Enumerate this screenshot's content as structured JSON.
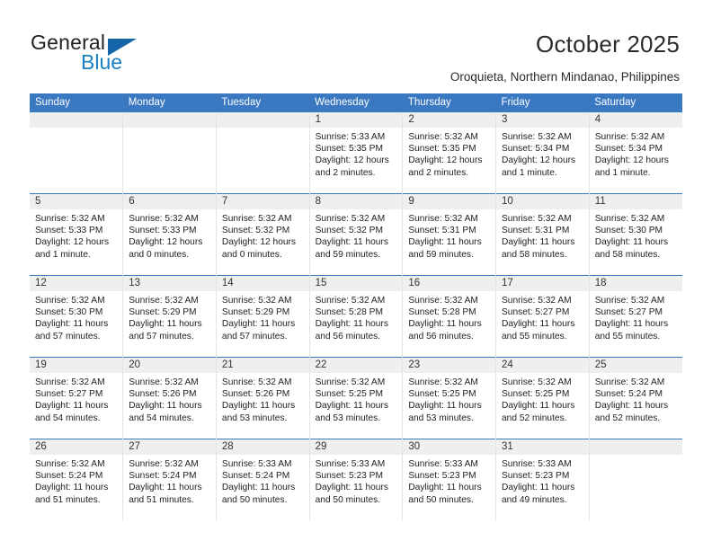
{
  "brand": {
    "name_top": "General",
    "name_bottom": "Blue",
    "accent_color": "#1a7fc1",
    "triangle_color": "#1565a8"
  },
  "header": {
    "title": "October 2025",
    "subtitle": "Oroquieta, Northern Mindanao, Philippines"
  },
  "colors": {
    "header_row_bg": "#3b78c2",
    "header_row_text": "#ffffff",
    "daynum_band_bg": "#efefef",
    "cell_divider": "#e4e4e4",
    "week_divider": "#3b78c2"
  },
  "weekdays": [
    "Sunday",
    "Monday",
    "Tuesday",
    "Wednesday",
    "Thursday",
    "Friday",
    "Saturday"
  ],
  "labels": {
    "sunrise_prefix": "Sunrise:",
    "sunset_prefix": "Sunset:",
    "daylight_prefix": "Daylight:"
  },
  "weeks": [
    [
      {
        "day": "",
        "empty": true
      },
      {
        "day": "",
        "empty": true
      },
      {
        "day": "",
        "empty": true
      },
      {
        "day": "1",
        "sunrise": "Sunrise: 5:33 AM",
        "sunset": "Sunset: 5:35 PM",
        "daylight_1": "Daylight: 12 hours",
        "daylight_2": "and 2 minutes."
      },
      {
        "day": "2",
        "sunrise": "Sunrise: 5:32 AM",
        "sunset": "Sunset: 5:35 PM",
        "daylight_1": "Daylight: 12 hours",
        "daylight_2": "and 2 minutes."
      },
      {
        "day": "3",
        "sunrise": "Sunrise: 5:32 AM",
        "sunset": "Sunset: 5:34 PM",
        "daylight_1": "Daylight: 12 hours",
        "daylight_2": "and 1 minute."
      },
      {
        "day": "4",
        "sunrise": "Sunrise: 5:32 AM",
        "sunset": "Sunset: 5:34 PM",
        "daylight_1": "Daylight: 12 hours",
        "daylight_2": "and 1 minute."
      }
    ],
    [
      {
        "day": "5",
        "sunrise": "Sunrise: 5:32 AM",
        "sunset": "Sunset: 5:33 PM",
        "daylight_1": "Daylight: 12 hours",
        "daylight_2": "and 1 minute."
      },
      {
        "day": "6",
        "sunrise": "Sunrise: 5:32 AM",
        "sunset": "Sunset: 5:33 PM",
        "daylight_1": "Daylight: 12 hours",
        "daylight_2": "and 0 minutes."
      },
      {
        "day": "7",
        "sunrise": "Sunrise: 5:32 AM",
        "sunset": "Sunset: 5:32 PM",
        "daylight_1": "Daylight: 12 hours",
        "daylight_2": "and 0 minutes."
      },
      {
        "day": "8",
        "sunrise": "Sunrise: 5:32 AM",
        "sunset": "Sunset: 5:32 PM",
        "daylight_1": "Daylight: 11 hours",
        "daylight_2": "and 59 minutes."
      },
      {
        "day": "9",
        "sunrise": "Sunrise: 5:32 AM",
        "sunset": "Sunset: 5:31 PM",
        "daylight_1": "Daylight: 11 hours",
        "daylight_2": "and 59 minutes."
      },
      {
        "day": "10",
        "sunrise": "Sunrise: 5:32 AM",
        "sunset": "Sunset: 5:31 PM",
        "daylight_1": "Daylight: 11 hours",
        "daylight_2": "and 58 minutes."
      },
      {
        "day": "11",
        "sunrise": "Sunrise: 5:32 AM",
        "sunset": "Sunset: 5:30 PM",
        "daylight_1": "Daylight: 11 hours",
        "daylight_2": "and 58 minutes."
      }
    ],
    [
      {
        "day": "12",
        "sunrise": "Sunrise: 5:32 AM",
        "sunset": "Sunset: 5:30 PM",
        "daylight_1": "Daylight: 11 hours",
        "daylight_2": "and 57 minutes."
      },
      {
        "day": "13",
        "sunrise": "Sunrise: 5:32 AM",
        "sunset": "Sunset: 5:29 PM",
        "daylight_1": "Daylight: 11 hours",
        "daylight_2": "and 57 minutes."
      },
      {
        "day": "14",
        "sunrise": "Sunrise: 5:32 AM",
        "sunset": "Sunset: 5:29 PM",
        "daylight_1": "Daylight: 11 hours",
        "daylight_2": "and 57 minutes."
      },
      {
        "day": "15",
        "sunrise": "Sunrise: 5:32 AM",
        "sunset": "Sunset: 5:28 PM",
        "daylight_1": "Daylight: 11 hours",
        "daylight_2": "and 56 minutes."
      },
      {
        "day": "16",
        "sunrise": "Sunrise: 5:32 AM",
        "sunset": "Sunset: 5:28 PM",
        "daylight_1": "Daylight: 11 hours",
        "daylight_2": "and 56 minutes."
      },
      {
        "day": "17",
        "sunrise": "Sunrise: 5:32 AM",
        "sunset": "Sunset: 5:27 PM",
        "daylight_1": "Daylight: 11 hours",
        "daylight_2": "and 55 minutes."
      },
      {
        "day": "18",
        "sunrise": "Sunrise: 5:32 AM",
        "sunset": "Sunset: 5:27 PM",
        "daylight_1": "Daylight: 11 hours",
        "daylight_2": "and 55 minutes."
      }
    ],
    [
      {
        "day": "19",
        "sunrise": "Sunrise: 5:32 AM",
        "sunset": "Sunset: 5:27 PM",
        "daylight_1": "Daylight: 11 hours",
        "daylight_2": "and 54 minutes."
      },
      {
        "day": "20",
        "sunrise": "Sunrise: 5:32 AM",
        "sunset": "Sunset: 5:26 PM",
        "daylight_1": "Daylight: 11 hours",
        "daylight_2": "and 54 minutes."
      },
      {
        "day": "21",
        "sunrise": "Sunrise: 5:32 AM",
        "sunset": "Sunset: 5:26 PM",
        "daylight_1": "Daylight: 11 hours",
        "daylight_2": "and 53 minutes."
      },
      {
        "day": "22",
        "sunrise": "Sunrise: 5:32 AM",
        "sunset": "Sunset: 5:25 PM",
        "daylight_1": "Daylight: 11 hours",
        "daylight_2": "and 53 minutes."
      },
      {
        "day": "23",
        "sunrise": "Sunrise: 5:32 AM",
        "sunset": "Sunset: 5:25 PM",
        "daylight_1": "Daylight: 11 hours",
        "daylight_2": "and 53 minutes."
      },
      {
        "day": "24",
        "sunrise": "Sunrise: 5:32 AM",
        "sunset": "Sunset: 5:25 PM",
        "daylight_1": "Daylight: 11 hours",
        "daylight_2": "and 52 minutes."
      },
      {
        "day": "25",
        "sunrise": "Sunrise: 5:32 AM",
        "sunset": "Sunset: 5:24 PM",
        "daylight_1": "Daylight: 11 hours",
        "daylight_2": "and 52 minutes."
      }
    ],
    [
      {
        "day": "26",
        "sunrise": "Sunrise: 5:32 AM",
        "sunset": "Sunset: 5:24 PM",
        "daylight_1": "Daylight: 11 hours",
        "daylight_2": "and 51 minutes."
      },
      {
        "day": "27",
        "sunrise": "Sunrise: 5:32 AM",
        "sunset": "Sunset: 5:24 PM",
        "daylight_1": "Daylight: 11 hours",
        "daylight_2": "and 51 minutes."
      },
      {
        "day": "28",
        "sunrise": "Sunrise: 5:33 AM",
        "sunset": "Sunset: 5:24 PM",
        "daylight_1": "Daylight: 11 hours",
        "daylight_2": "and 50 minutes."
      },
      {
        "day": "29",
        "sunrise": "Sunrise: 5:33 AM",
        "sunset": "Sunset: 5:23 PM",
        "daylight_1": "Daylight: 11 hours",
        "daylight_2": "and 50 minutes."
      },
      {
        "day": "30",
        "sunrise": "Sunrise: 5:33 AM",
        "sunset": "Sunset: 5:23 PM",
        "daylight_1": "Daylight: 11 hours",
        "daylight_2": "and 50 minutes."
      },
      {
        "day": "31",
        "sunrise": "Sunrise: 5:33 AM",
        "sunset": "Sunset: 5:23 PM",
        "daylight_1": "Daylight: 11 hours",
        "daylight_2": "and 49 minutes."
      },
      {
        "day": "",
        "empty": true
      }
    ]
  ]
}
